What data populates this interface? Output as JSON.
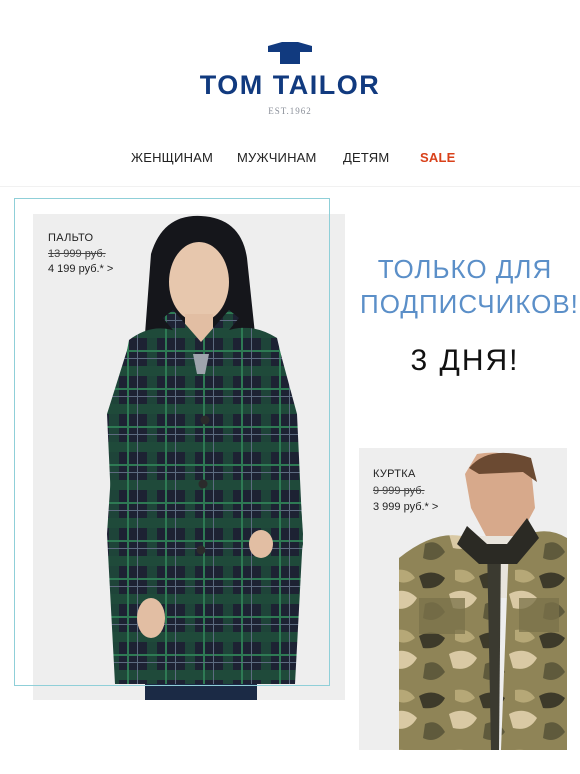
{
  "brand": {
    "name": "TOM TAILOR",
    "established": "EST.1962",
    "color": "#113a7f"
  },
  "nav": {
    "items": [
      {
        "label": "ЖЕНЩИНАМ"
      },
      {
        "label": "МУЖЧИНАМ"
      },
      {
        "label": "ДЕТЯМ"
      },
      {
        "label": "SALE",
        "color": "#d9411a"
      }
    ]
  },
  "products": [
    {
      "name": "ПАЛЬТО",
      "old_price": "13 999 руб.",
      "new_price": "4 199 руб.* >",
      "image_icon": "plaid-coat-model-image"
    },
    {
      "name": "КУРТКА",
      "old_price": "9 999 руб.",
      "new_price": "3 999 руб.* >",
      "image_icon": "camo-jacket-model-image"
    }
  ],
  "promo": {
    "line1": "ТОЛЬКО ДЛЯ",
    "line2": "ПОДПИСЧИКОВ!",
    "line3": "3 ДНЯ!",
    "accent": "#5b8fc8"
  },
  "frame_color": "#8fcfd8"
}
